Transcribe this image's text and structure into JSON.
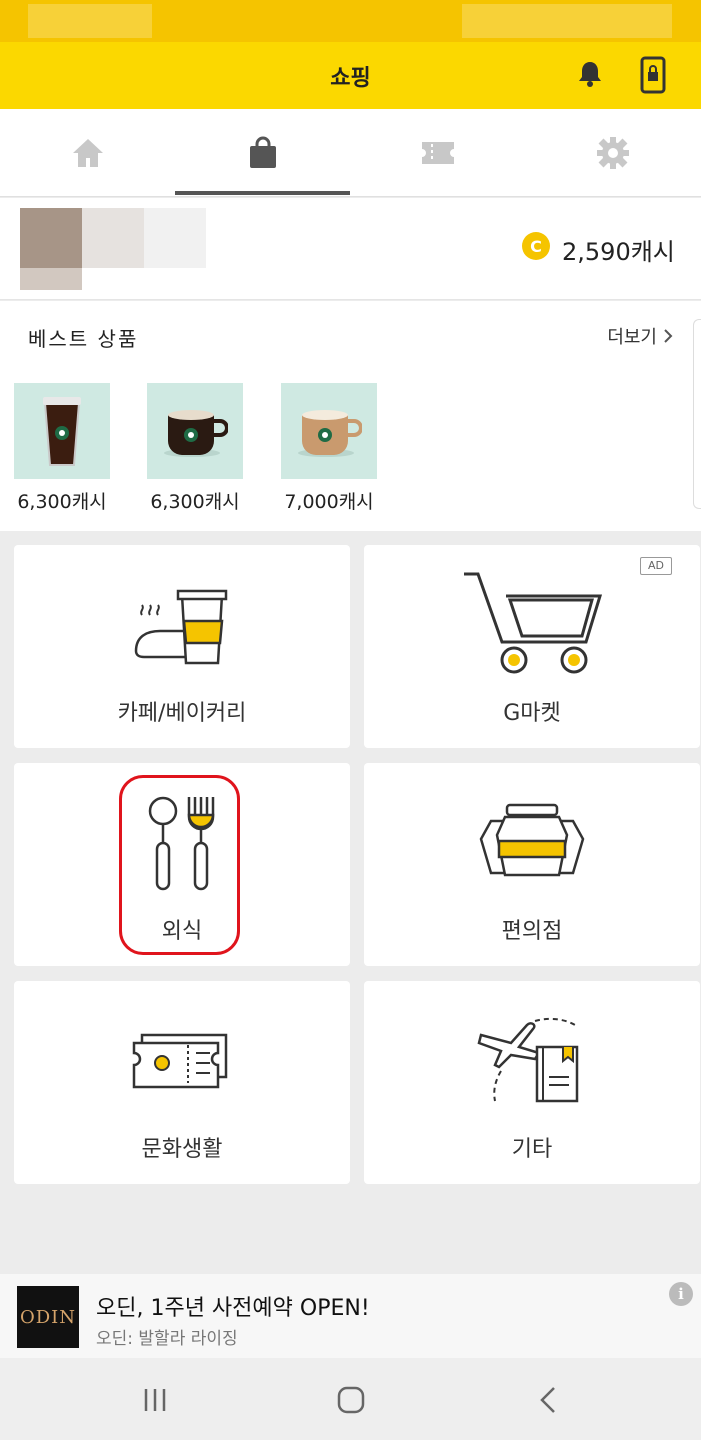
{
  "header": {
    "title": "쇼핑",
    "icons": [
      "bell-icon",
      "phone-lock-icon"
    ]
  },
  "tabs": [
    {
      "name": "home",
      "icon": "home-icon"
    },
    {
      "name": "shopping",
      "icon": "shopping-bag-icon",
      "selected": true
    },
    {
      "name": "ticket",
      "icon": "ticket-icon"
    },
    {
      "name": "settings",
      "icon": "gear-icon"
    }
  ],
  "profile": {
    "cash": "2,590캐시",
    "coin_icon_label": "C"
  },
  "best": {
    "title": "베스트 상품",
    "more_label": "더보기",
    "products": [
      {
        "price": "6,300캐시",
        "icon": "iced-coffee-icon"
      },
      {
        "price": "6,300캐시",
        "icon": "hot-coffee-mug-icon"
      },
      {
        "price": "7,000캐시",
        "icon": "latte-mug-icon"
      }
    ]
  },
  "categories": [
    {
      "label": "카페/베이커리",
      "icon": "cafe-bakery-icon"
    },
    {
      "label": "G마켓",
      "icon": "shopping-cart-icon",
      "badge": "AD"
    },
    {
      "label": "외식",
      "icon": "spoon-fork-icon"
    },
    {
      "label": "편의점",
      "icon": "convenience-store-icon"
    },
    {
      "label": "문화생활",
      "icon": "ticket-culture-icon"
    },
    {
      "label": "기타",
      "icon": "travel-book-icon"
    }
  ],
  "banner": {
    "logo_text": "ODIN",
    "title": "오딘, 1주년 사전예약 OPEN!",
    "subtitle": "오딘: 발할라 라이징",
    "info_label": "i"
  },
  "colors": {
    "brand_yellow": "#fbd800",
    "status_yellow": "#f5c400",
    "accent_red": "#e0141c"
  }
}
